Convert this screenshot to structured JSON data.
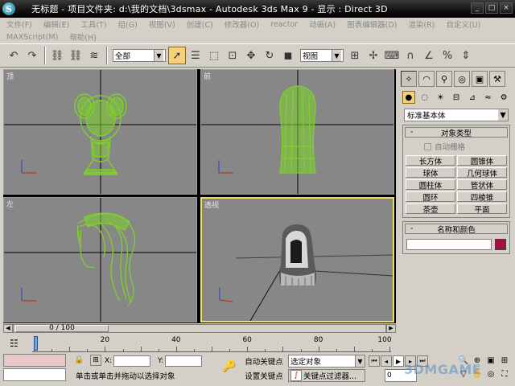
{
  "window": {
    "title": "无标题      - 项目文件夹: d:\\我的文档\\3dsmax      - Autodesk 3ds Max 9      - 显示 : Direct 3D",
    "app_icon_letter": "S",
    "controls": [
      "_",
      "□",
      "×"
    ]
  },
  "menu": {
    "row1": [
      "文件(F)",
      "编辑(E)",
      "工具(T)",
      "组(G)",
      "视图(V)",
      "创建(C)",
      "修改器(O)",
      "reactor",
      "动画(A)",
      "图表编辑器(D)",
      "渲染(R)",
      "自定义(U)"
    ],
    "row2": [
      "MAXScript(M)",
      "帮助(H)"
    ]
  },
  "toolbar": {
    "selection_filter": "全部",
    "reference_coord": "视图"
  },
  "viewports": [
    {
      "label": "顶",
      "active": false
    },
    {
      "label": "前",
      "active": false
    },
    {
      "label": "左",
      "active": false
    },
    {
      "label": "透视",
      "active": true
    }
  ],
  "command_panel": {
    "category": "标准基本体",
    "object_type_header": "对象类型",
    "autogrid_label": "自动栅格",
    "buttons": [
      "长方体",
      "圆锥体",
      "球体",
      "几何球体",
      "圆柱体",
      "管状体",
      "圆环",
      "四棱锥",
      "茶壶",
      "平面"
    ],
    "name_color_header": "名称和颜色",
    "object_color": "#a01040"
  },
  "timeline": {
    "slider_label": "0 / 100",
    "ticks": [
      "20",
      "40",
      "60",
      "80",
      "100"
    ]
  },
  "status": {
    "prompt": "单击或单击并拖动以选择对象",
    "coord_x_label": "X:",
    "coord_y_label": "Y:",
    "autokey_label": "自动关键点",
    "setkey_label": "设置关键点",
    "key_mode_select": "选定对象",
    "key_filters_label": "关键点过滤器...",
    "frame_value": "0"
  },
  "watermark": "3DMGAME",
  "colors": {
    "wireframe": "#7ed12a",
    "viewport_bg": "#878787",
    "active_border": "#f0e05a"
  }
}
